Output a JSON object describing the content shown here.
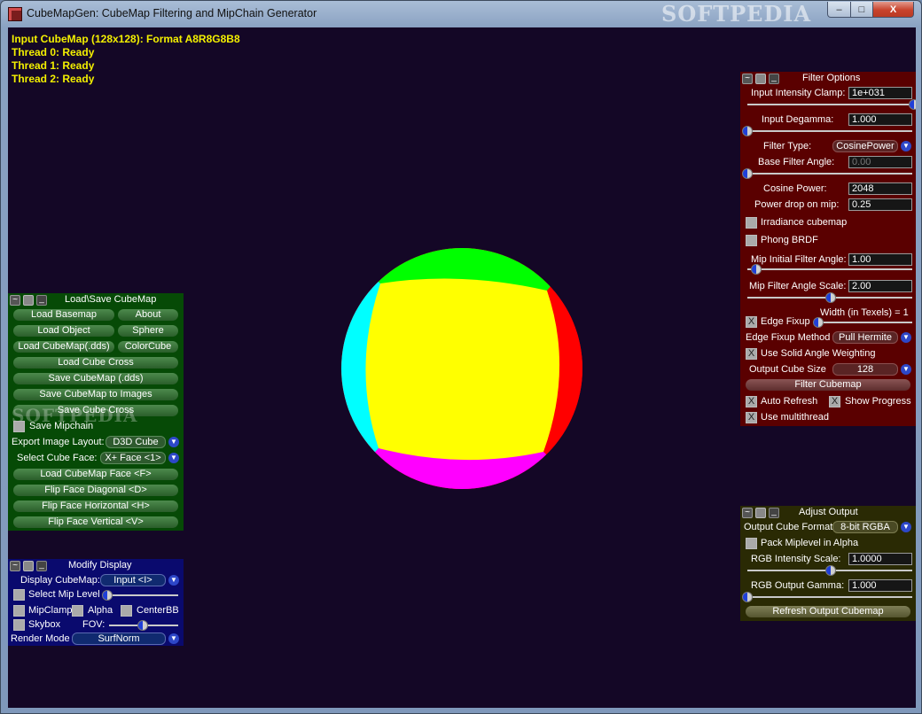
{
  "window": {
    "title": "CubeMapGen: CubeMap Filtering and MipChain Generator",
    "watermark": "SOFTPEDIA",
    "controls": {
      "minimize": "–",
      "maximize": "□",
      "close": "X"
    }
  },
  "status": [
    "Input CubeMap (128x128): Format A8R8G8B8",
    "Thread 0: Ready",
    "Thread 1: Ready",
    "Thread 2: Ready"
  ],
  "colors": {
    "viewport_bg": "#140726",
    "status_text": "#f4f000",
    "sphere_yellow": "#ffff00",
    "sphere_green": "#00ff00",
    "sphere_red": "#ff0000",
    "sphere_cyan": "#00ffff",
    "sphere_magenta": "#ff00ff",
    "load_save_panel": "#064a06",
    "modify_display_panel": "#0a0a6e",
    "filter_options_panel": "#5a0000",
    "adjust_output_panel": "#2a2a04"
  },
  "panel_controls": {
    "toggle": "~",
    "gear": "",
    "minimize": "_"
  },
  "dropdown_arrow": "▼",
  "check_mark": "X",
  "load_save": {
    "title": "Load\\Save CubeMap",
    "load_basemap": "Load Basemap",
    "about": "About",
    "load_object": "Load Object",
    "sphere": "Sphere",
    "load_cubemap_dds": "Load CubeMap(.dds)",
    "color_cube": "ColorCube",
    "load_cube_cross": "Load Cube Cross",
    "save_cubemap_dds": "Save CubeMap (.dds)",
    "save_cubemap_images": "Save CubeMap to Images",
    "save_cube_cross": "Save Cube Cross",
    "save_mipchain": "Save Mipchain",
    "export_layout_label": "Export Image Layout:",
    "export_layout_value": "D3D Cube",
    "select_face_label": "Select Cube Face:",
    "select_face_value": "X+ Face <1>",
    "load_face": "Load CubeMap Face   <F>",
    "flip_diagonal": "Flip Face Diagonal   <D>",
    "flip_horizontal": "Flip Face Horizontal   <H>",
    "flip_vertical": "Flip Face Vertical   <V>",
    "watermark": "SOFTPEDIA"
  },
  "modify_display": {
    "title": "Modify Display",
    "display_label": "Display CubeMap:",
    "display_value": "Input <I>",
    "select_mip": "Select Mip Level",
    "mipclamp": "MipClamp",
    "alpha": "Alpha",
    "centerbb": "CenterBB",
    "skybox": "Skybox",
    "fov": "FOV:",
    "render_mode_label": "Render Mode",
    "render_mode_value": "SurfNorm"
  },
  "filter_options": {
    "title": "Filter Options",
    "intensity_clamp_label": "Input Intensity Clamp:",
    "intensity_clamp_value": "1e+031",
    "degamma_label": "Input Degamma:",
    "degamma_value": "1.000",
    "filter_type_label": "Filter Type:",
    "filter_type_value": "CosinePower",
    "base_angle_label": "Base Filter Angle:",
    "base_angle_value": "0.00",
    "cosine_power_label": "Cosine Power:",
    "cosine_power_value": "2048",
    "power_drop_label": "Power drop on mip:",
    "power_drop_value": "0.25",
    "irradiance": "Irradiance cubemap",
    "phong_brdf": "Phong BRDF",
    "mip_initial_label": "Mip Initial Filter Angle:",
    "mip_initial_value": "1.00",
    "mip_scale_label": "Mip Filter Angle Scale:",
    "mip_scale_value": "2.00",
    "width_texels": "Width (in Texels) = 1",
    "edge_fixup": "Edge Fixup",
    "edge_method_label": "Edge Fixup Method",
    "edge_method_value": "Pull Hermite",
    "solid_angle": "Use Solid Angle Weighting",
    "output_size_label": "Output Cube Size",
    "output_size_value": "128",
    "filter_cubemap": "Filter Cubemap",
    "auto_refresh": "Auto Refresh",
    "show_progress": "Show Progress",
    "use_multithread": "Use multithread"
  },
  "adjust_output": {
    "title": "Adjust Output",
    "format_label": "Output Cube Format",
    "format_value": "8-bit RGBA",
    "pack_miplevel": "Pack Miplevel in Alpha",
    "rgb_scale_label": "RGB Intensity Scale:",
    "rgb_scale_value": "1.0000",
    "rgb_gamma_label": "RGB Output Gamma:",
    "rgb_gamma_value": "1.000",
    "refresh": "Refresh Output Cubemap"
  }
}
